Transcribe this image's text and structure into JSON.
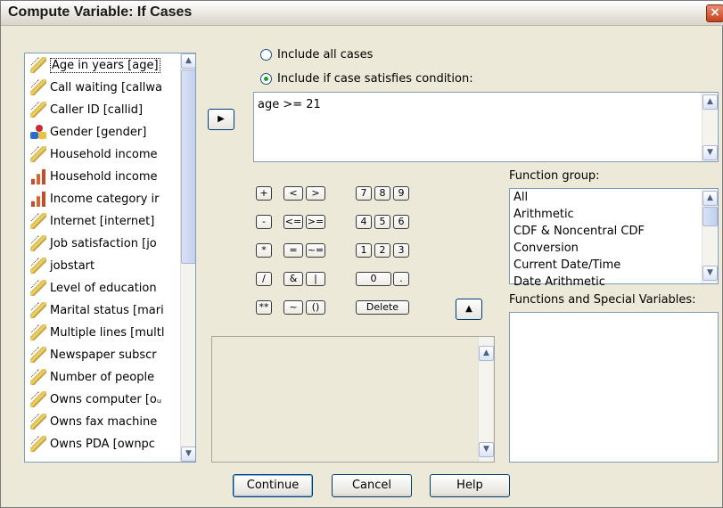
{
  "window": {
    "title": "Compute Variable: If Cases",
    "close_glyph": "×"
  },
  "variables": [
    {
      "label": "Age in years [age]",
      "icon": "scale-ruler-icon"
    },
    {
      "label": "Call waiting [callwa",
      "icon": "scale-ruler-icon"
    },
    {
      "label": "Caller ID [callid]",
      "icon": "scale-ruler-icon"
    },
    {
      "label": "Gender [gender]",
      "icon": "nominal-icon"
    },
    {
      "label": "Household income",
      "icon": "scale-ruler-icon"
    },
    {
      "label": "Household income",
      "icon": "ordinal-bars-icon"
    },
    {
      "label": "Income category ir",
      "icon": "ordinal-bars-icon"
    },
    {
      "label": "Internet [internet]",
      "icon": "scale-ruler-icon"
    },
    {
      "label": "Job satisfaction [jo",
      "icon": "scale-ruler-icon"
    },
    {
      "label": "jobstart",
      "icon": "scale-ruler-icon"
    },
    {
      "label": "Level of education",
      "icon": "scale-ruler-icon"
    },
    {
      "label": "Marital status [mari",
      "icon": "scale-ruler-icon"
    },
    {
      "label": "Multiple lines [multl",
      "icon": "scale-ruler-icon"
    },
    {
      "label": "Newspaper subscr",
      "icon": "scale-ruler-icon"
    },
    {
      "label": "Number of people",
      "icon": "scale-ruler-icon"
    },
    {
      "label": "Owns computer [oᵤ",
      "icon": "scale-ruler-icon"
    },
    {
      "label": "Owns fax machine",
      "icon": "scale-ruler-icon"
    },
    {
      "label": "Owns PDA [ownpc",
      "icon": "scale-ruler-icon"
    }
  ],
  "radios": {
    "all_cases": "Include all cases",
    "if_condition": "Include if case satisfies condition:",
    "selected": "if_condition"
  },
  "condition": {
    "expression": "age >= 21"
  },
  "keypad": {
    "row1": [
      "+",
      "<",
      ">",
      "7",
      "8",
      "9"
    ],
    "row2": [
      "-",
      "<=",
      ">=",
      "4",
      "5",
      "6"
    ],
    "row3": [
      "*",
      "=",
      "~=",
      "1",
      "2",
      "3"
    ],
    "row4": [
      "/",
      "&",
      "|",
      "0",
      "."
    ],
    "row5": [
      "**",
      "~",
      "()",
      "Delete"
    ]
  },
  "function_group": {
    "label": "Function group:",
    "items": [
      "All",
      "Arithmetic",
      "CDF & Noncentral CDF",
      "Conversion",
      "Current Date/Time",
      "Date Arithmetic"
    ]
  },
  "functions_label": "Functions and Special Variables:",
  "buttons": {
    "continue": "Continue",
    "cancel": "Cancel",
    "help": "Help"
  },
  "arrows": {
    "move_right": "▶",
    "move_up": "▲",
    "scroll_up": "▲",
    "scroll_down": "▼"
  }
}
